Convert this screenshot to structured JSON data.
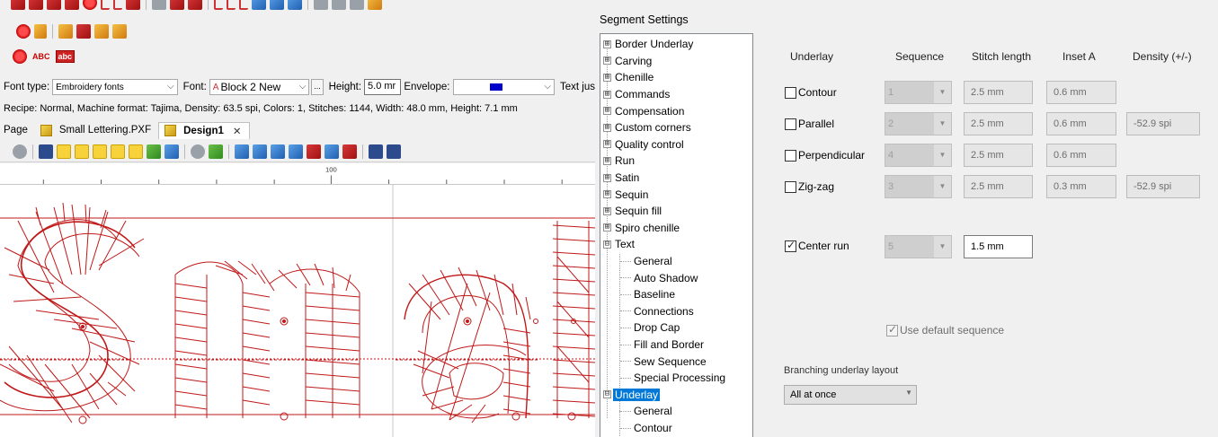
{
  "editor": {
    "font_row": {
      "font_type_label": "Font type:",
      "font_type_value": "Embroidery fonts",
      "font_label": "Font:",
      "font_value": "Block 2 New",
      "more_label": "...",
      "height_label": "Height:",
      "height_value": "5.0 mr",
      "envelope_label": "Envelope:",
      "text_jus_label": "Text jus"
    },
    "recipe": "Recipe: Normal, Machine format: Tajima, Density: 63.5 spi, Colors: 1, Stitches: 1144, Width: 48.0 mm, Height:  7.1 mm",
    "tabs": [
      {
        "label": "Page"
      },
      {
        "label": "Small Lettering.PXF"
      },
      {
        "label": "Design1",
        "close": "✕"
      }
    ],
    "ruler_label": "100",
    "stitch_color": "#c01818"
  },
  "dialog": {
    "title": "Segment Settings",
    "tree": {
      "expanded_symbol": "⊟",
      "collapsed_symbol": "⊞",
      "top": [
        "Border Underlay",
        "Carving",
        "Chenille",
        "Commands",
        "Compensation",
        "Custom corners",
        "Quality control",
        "Run",
        "Satin",
        "Sequin",
        "Sequin fill",
        "Spiro chenille"
      ],
      "text_node": "Text",
      "text_children": [
        "General",
        "Auto Shadow",
        "Baseline",
        "Connections",
        "Drop Cap",
        "Fill and Border",
        "Sew Sequence",
        "Special Processing"
      ],
      "underlay_node": "Underlay",
      "underlay_children": [
        "General",
        "Contour"
      ]
    },
    "panel": {
      "headers": {
        "underlay": "Underlay",
        "sequence": "Sequence",
        "stitch_length": "Stitch length",
        "inset_a": "Inset A",
        "density": "Density (+/-)"
      },
      "rows": [
        {
          "label": "Contour",
          "checked": false,
          "sequence": "1",
          "stitch_length": "2.5 mm",
          "inset": "0.6 mm",
          "density": ""
        },
        {
          "label": "Parallel",
          "checked": false,
          "sequence": "2",
          "stitch_length": "2.5 mm",
          "inset": "0.6 mm",
          "density": "-52.9 spi"
        },
        {
          "label": "Perpendicular",
          "checked": false,
          "sequence": "4",
          "stitch_length": "2.5 mm",
          "inset": "0.6 mm",
          "density": ""
        },
        {
          "label": "Zig-zag",
          "checked": false,
          "sequence": "3",
          "stitch_length": "2.5 mm",
          "inset": "0.3 mm",
          "density": "-52.9 spi"
        }
      ],
      "center_run": {
        "label": "Center run",
        "checked": true,
        "sequence": "5",
        "stitch_length": "1.5 mm"
      },
      "use_default_sequence": {
        "label": "Use default sequence",
        "checked": true
      },
      "branching_label": "Branching underlay layout",
      "branching_value": "All at once"
    }
  }
}
